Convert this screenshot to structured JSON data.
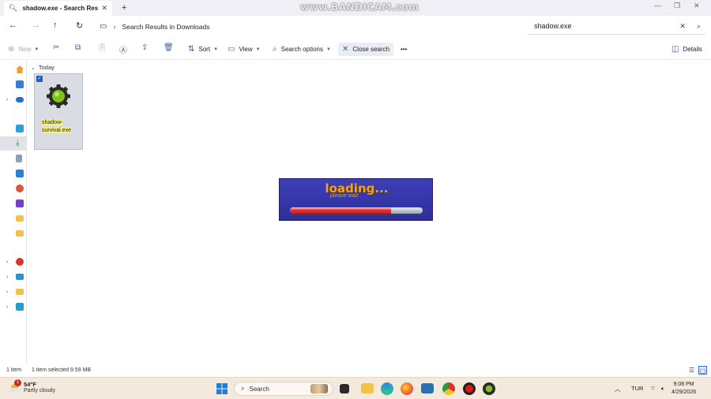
{
  "window": {
    "tab_title": "shadow.exe - Search Results i",
    "new_tab": "+",
    "watermark": "www.BANDICAM.com"
  },
  "address": {
    "location": "Search Results in Downloads",
    "search_value": "shadow.exe"
  },
  "toolbar": {
    "new_label": "New",
    "sort_label": "Sort",
    "view_label": "View",
    "search_options_label": "Search options",
    "close_search_label": "Close search",
    "more_label": "•••",
    "details_label": "Details"
  },
  "content": {
    "group_label": "Today",
    "file": {
      "name_line1": "shadow-",
      "name_line2": "survival.exe",
      "selected": true
    }
  },
  "splash": {
    "title": "loading...",
    "subtitle": "please wait",
    "progress": 0.76
  },
  "status": {
    "item_count": "1 item",
    "selection": "1 item selected  9.59 MB"
  },
  "taskbar": {
    "weather_temp": "54°F",
    "weather_desc": "Partly cloudy",
    "weather_badge": "1",
    "search_label": "Search",
    "language": "TUR",
    "time": "9:08 PM",
    "date": "4/29/2026"
  },
  "colors": {
    "accent": "#3a5fa8",
    "selection_bg": "#d9dce2",
    "taskbar_bg": "#f3e9dc",
    "splash_bg": "#3435a6",
    "splash_title": "#f4a21a"
  }
}
